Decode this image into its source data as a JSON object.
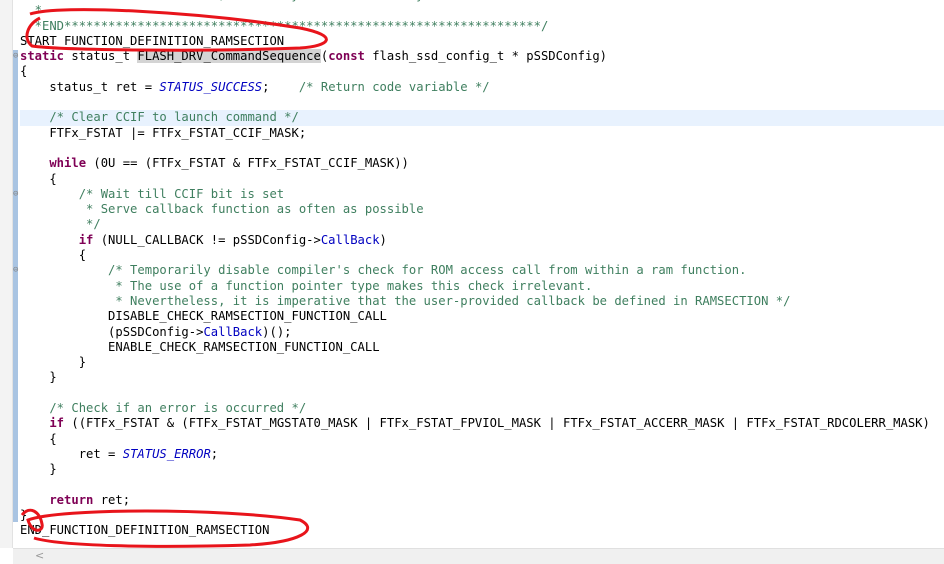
{
  "editor": {
    "lines": [
      [
        [
          "cm",
          "  * It is internal function, called by driver APIs only."
        ]
      ],
      [
        [
          "cm",
          "  *"
        ]
      ],
      [
        [
          "cm",
          "  *END*****************************************************************/"
        ]
      ],
      [
        [
          "tx",
          "START_FUNCTION_DEFINITION_RAMSECTION"
        ]
      ],
      [
        [
          "kw",
          "static"
        ],
        [
          "tx",
          " status_t "
        ],
        [
          "hl",
          "FLASH_DRV_CommandSequence"
        ],
        [
          "tx",
          "("
        ],
        [
          "kw",
          "const"
        ],
        [
          "tx",
          " flash_ssd_config_t * pSSDConfig)"
        ]
      ],
      [
        [
          "tx",
          "{"
        ]
      ],
      [
        [
          "tx",
          "    status_t ret = "
        ],
        [
          "en",
          "STATUS_SUCCESS"
        ],
        [
          "tx",
          ";    "
        ],
        [
          "cm",
          "/* Return code variable */"
        ]
      ],
      [
        [
          "tx",
          ""
        ]
      ],
      [
        [
          "cm",
          "    /* Clear CCIF to launch command */"
        ]
      ],
      [
        [
          "tx",
          "    FTFx_FSTAT |= FTFx_FSTAT_CCIF_MASK;"
        ]
      ],
      [
        [
          "tx",
          ""
        ]
      ],
      [
        [
          "kw",
          "    while"
        ],
        [
          "tx",
          " (0U == (FTFx_FSTAT & FTFx_FSTAT_CCIF_MASK))"
        ]
      ],
      [
        [
          "tx",
          "    {"
        ]
      ],
      [
        [
          "cm",
          "        /* Wait till CCIF bit is set"
        ]
      ],
      [
        [
          "cm",
          "         * Serve callback function as often as possible"
        ]
      ],
      [
        [
          "cm",
          "         */"
        ]
      ],
      [
        [
          "kw",
          "        if"
        ],
        [
          "tx",
          " (NULL_CALLBACK != pSSDConfig->"
        ],
        [
          "fld",
          "CallBack"
        ],
        [
          "tx",
          ")"
        ]
      ],
      [
        [
          "tx",
          "        {"
        ]
      ],
      [
        [
          "cm",
          "            /* Temporarily disable compiler's check for ROM access call from within a ram function."
        ]
      ],
      [
        [
          "cm",
          "             * The use of a function pointer type makes this check irrelevant."
        ]
      ],
      [
        [
          "cm",
          "             * Nevertheless, it is imperative that the user-provided callback be defined in RAMSECTION */"
        ]
      ],
      [
        [
          "tx",
          "            DISABLE_CHECK_RAMSECTION_FUNCTION_CALL"
        ]
      ],
      [
        [
          "tx",
          "            (pSSDConfig->"
        ],
        [
          "fld",
          "CallBack"
        ],
        [
          "tx",
          ")();"
        ]
      ],
      [
        [
          "tx",
          "            ENABLE_CHECK_RAMSECTION_FUNCTION_CALL"
        ]
      ],
      [
        [
          "tx",
          "        }"
        ]
      ],
      [
        [
          "tx",
          "    }"
        ]
      ],
      [
        [
          "tx",
          ""
        ]
      ],
      [
        [
          "cm",
          "    /* Check if an error is occurred */"
        ]
      ],
      [
        [
          "kw",
          "    if"
        ],
        [
          "tx",
          " ((FTFx_FSTAT & (FTFx_FSTAT_MGSTAT0_MASK | FTFx_FSTAT_FPVIOL_MASK | FTFx_FSTAT_ACCERR_MASK | FTFx_FSTAT_RDCOLERR_MASK)"
        ]
      ],
      [
        [
          "tx",
          "    {"
        ]
      ],
      [
        [
          "tx",
          "        ret = "
        ],
        [
          "en",
          "STATUS_ERROR"
        ],
        [
          "tx",
          ";"
        ]
      ],
      [
        [
          "tx",
          "    }"
        ]
      ],
      [
        [
          "tx",
          ""
        ]
      ],
      [
        [
          "kw",
          "    return"
        ],
        [
          "tx",
          " ret;"
        ]
      ],
      [
        [
          "tx",
          "}"
        ]
      ],
      [
        [
          "tx",
          "END_FUNCTION_DEFINITION_RAMSECTION"
        ]
      ]
    ],
    "current_line": 8,
    "fold_lines": [
      4,
      13,
      18
    ],
    "scroll_left_glyph": "<"
  },
  "annotation_color": "#e8141b"
}
